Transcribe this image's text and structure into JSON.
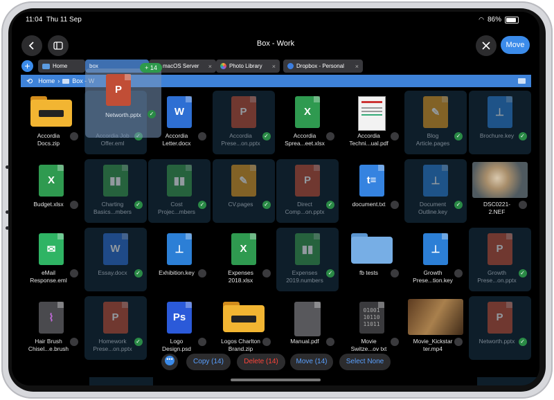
{
  "status": {
    "time": "11:04",
    "date": "Thu 11 Sep",
    "battery": "86%"
  },
  "nav": {
    "title": "Box - Work",
    "move_label": "Move"
  },
  "tabs": [
    {
      "label": "Home"
    },
    {
      "label": "box"
    },
    {
      "label": "macOS Server"
    },
    {
      "label": "Photo Library"
    },
    {
      "label": "Dropbox - Personal"
    }
  ],
  "path": {
    "home": "Home",
    "current": "Box - W"
  },
  "drag": {
    "count": "+ 14",
    "filename": "Networth.pptx"
  },
  "files": [
    {
      "name": "Accordia Docs.zip",
      "kind": "zipfolder",
      "selected": false
    },
    {
      "name": "Accordia Job Offer.eml",
      "kind": "blank",
      "selected": true
    },
    {
      "name": "Accordia Letter.docx",
      "kind": "word",
      "selected": false
    },
    {
      "name": "Accordia Prese...on.pptx",
      "kind": "ppt",
      "selected": true
    },
    {
      "name": "Accordia Sprea...eet.xlsx",
      "kind": "xls",
      "selected": false
    },
    {
      "name": "Accordia Techni...ual.pdf",
      "kind": "pdf",
      "selected": false
    },
    {
      "name": "Blog Article.pages",
      "kind": "pages",
      "selected": true
    },
    {
      "name": "Brochure.key",
      "kind": "key",
      "selected": true
    },
    {
      "name": "Budget.xlsx",
      "kind": "xls",
      "selected": false
    },
    {
      "name": "Charting Basics...mbers",
      "kind": "num",
      "selected": true
    },
    {
      "name": "Cost Projec...mbers",
      "kind": "num",
      "selected": true
    },
    {
      "name": "CV.pages",
      "kind": "pages",
      "selected": true
    },
    {
      "name": "Direct Comp...on.pptx",
      "kind": "ppt",
      "selected": true
    },
    {
      "name": "document.txt",
      "kind": "txt",
      "selected": false
    },
    {
      "name": "Document Outline.key",
      "kind": "key",
      "selected": true
    },
    {
      "name": "DSC0221-2.NEF",
      "kind": "photo-owl",
      "selected": false
    },
    {
      "name": "eMail Response.eml",
      "kind": "mail",
      "selected": false
    },
    {
      "name": "Essay.docx",
      "kind": "word",
      "selected": true
    },
    {
      "name": "Exhibition.key",
      "kind": "key",
      "selected": false
    },
    {
      "name": "Expenses 2018.xlsx",
      "kind": "xls",
      "selected": false
    },
    {
      "name": "Expenses 2019.numbers",
      "kind": "num",
      "selected": true
    },
    {
      "name": "fb tests",
      "kind": "bluefolder",
      "selected": false
    },
    {
      "name": "Growth Prese...tion.key",
      "kind": "key",
      "selected": false
    },
    {
      "name": "Growth Prese...on.pptx",
      "kind": "ppt",
      "selected": true
    },
    {
      "name": "Hair Brush Chisel...e.brush",
      "kind": "brush",
      "selected": false
    },
    {
      "name": "Homework Prese...on.pptx",
      "kind": "ppt",
      "selected": true
    },
    {
      "name": "Logo Design.psd",
      "kind": "ps",
      "selected": false
    },
    {
      "name": "Logos Charlton Brand.zip",
      "kind": "zipfolder",
      "selected": false
    },
    {
      "name": "Manual.pdf",
      "kind": "manual",
      "selected": false
    },
    {
      "name": "Movie Switze...ov txt",
      "kind": "binary",
      "selected": false
    },
    {
      "name": "Movie_Kickstar ter.mp4",
      "kind": "photo-movie",
      "selected": false
    },
    {
      "name": "Networth.pptx",
      "kind": "ppt",
      "selected": true
    }
  ],
  "actions": {
    "copy": "Copy (14)",
    "delete": "Delete (14)",
    "move": "Move (14)",
    "select_none": "Select None"
  },
  "colors": {
    "accent": "#3b8bea",
    "selected_bg": "#0e1e2a",
    "check": "#2a8a46",
    "delete": "#ff453a"
  }
}
